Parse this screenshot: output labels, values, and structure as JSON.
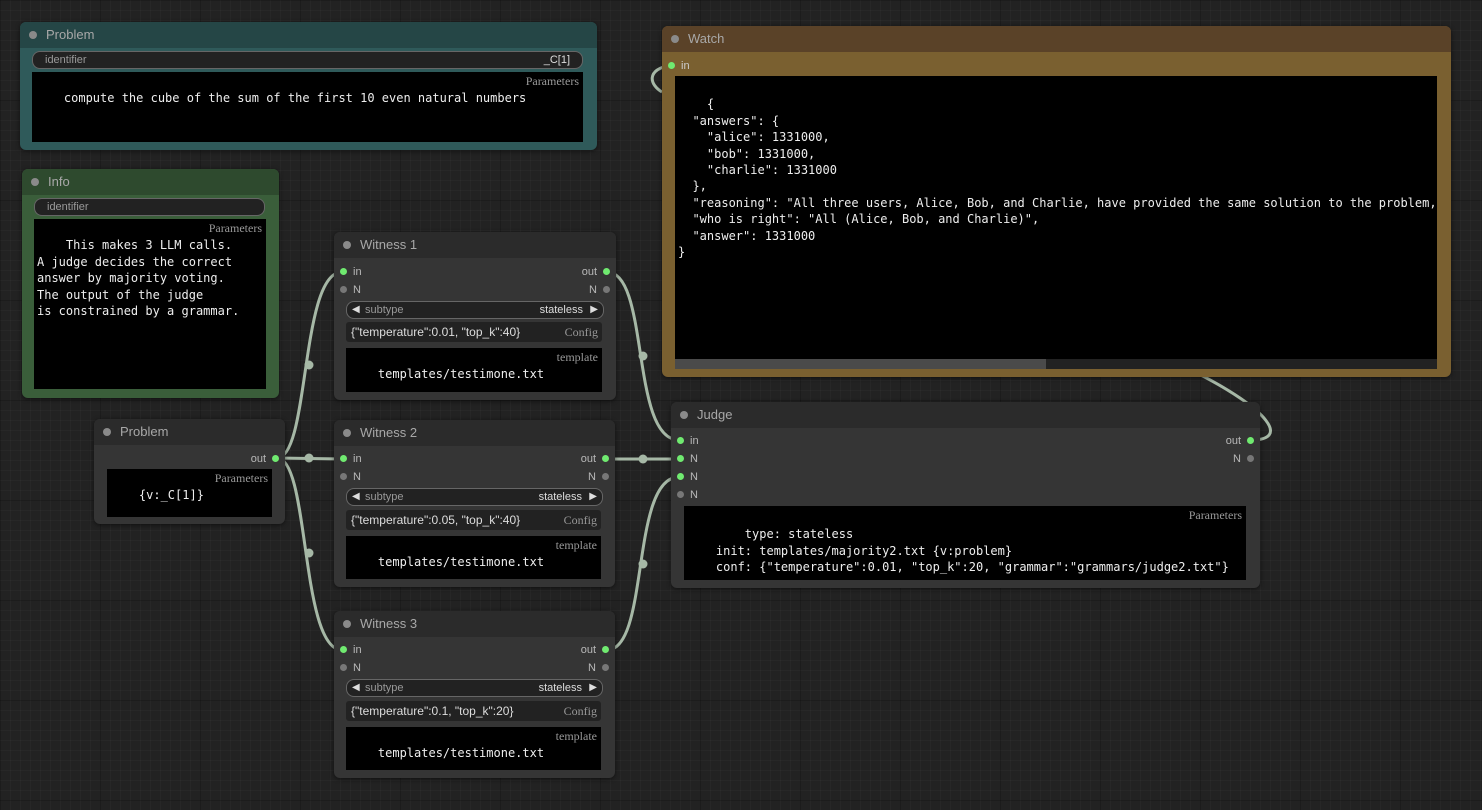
{
  "nodes": {
    "problem_top": {
      "title": "Problem",
      "identifier_label": "identifier",
      "identifier_value": "_C[1]",
      "params_tag": "Parameters",
      "params_text": "compute the cube of the sum of the first 10 even natural numbers"
    },
    "info": {
      "title": "Info",
      "identifier_label": "identifier",
      "params_tag": "Parameters",
      "params_text": "This makes 3 LLM calls.\nA judge decides the correct\nanswer by majority voting.\nThe output of the judge\nis constrained by a grammar."
    },
    "problem_small": {
      "title": "Problem",
      "out_label": "out",
      "params_tag": "Parameters",
      "params_text": "{v:_C[1]}"
    },
    "witness1": {
      "title": "Witness 1",
      "in_label": "in",
      "out_label": "out",
      "n_label": "N",
      "subtype_label": "subtype",
      "subtype_value": "stateless",
      "config_value": "{\"temperature\":0.01, \"top_k\":40}",
      "config_tag": "Config",
      "template_text": "templates/testimone.txt",
      "template_tag": "template"
    },
    "witness2": {
      "title": "Witness 2",
      "in_label": "in",
      "out_label": "out",
      "n_label": "N",
      "subtype_label": "subtype",
      "subtype_value": "stateless",
      "config_value": "{\"temperature\":0.05, \"top_k\":40}",
      "config_tag": "Config",
      "template_text": "templates/testimone.txt",
      "template_tag": "template"
    },
    "witness3": {
      "title": "Witness 3",
      "in_label": "in",
      "out_label": "out",
      "n_label": "N",
      "subtype_label": "subtype",
      "subtype_value": "stateless",
      "config_value": "{\"temperature\":0.1, \"top_k\":20}",
      "config_tag": "Config",
      "template_text": "templates/testimone.txt",
      "template_tag": "template"
    },
    "watch": {
      "title": "Watch",
      "in_label": "in",
      "output_text": "{\n  \"answers\": {\n    \"alice\": 1331000,\n    \"bob\": 1331000,\n    \"charlie\": 1331000\n  },\n  \"reasoning\": \"All three users, Alice, Bob, and Charlie, have provided the same solution to the problem,\n  \"who is right\": \"All (Alice, Bob, and Charlie)\",\n  \"answer\": 1331000\n}"
    },
    "judge": {
      "title": "Judge",
      "in_label": "in",
      "out_label": "out",
      "n_label": "N",
      "params_tag": "Parameters",
      "params_text": "    type: stateless\n    init: templates/majority2.txt {v:problem}\n    conf: {\"temperature\":0.01, \"top_k\":20, \"grammar\":\"grammars/judge2.txt\"}"
    }
  },
  "colors": {
    "canvas": "#222222",
    "node_body": "#353535",
    "problem_node": "#2f5a5a",
    "info_node": "#3a5e3a",
    "watch_node": "#7a6030",
    "port_connected": "#70ea70",
    "port_idle": "#777777",
    "wire": "#a6b8a6"
  }
}
